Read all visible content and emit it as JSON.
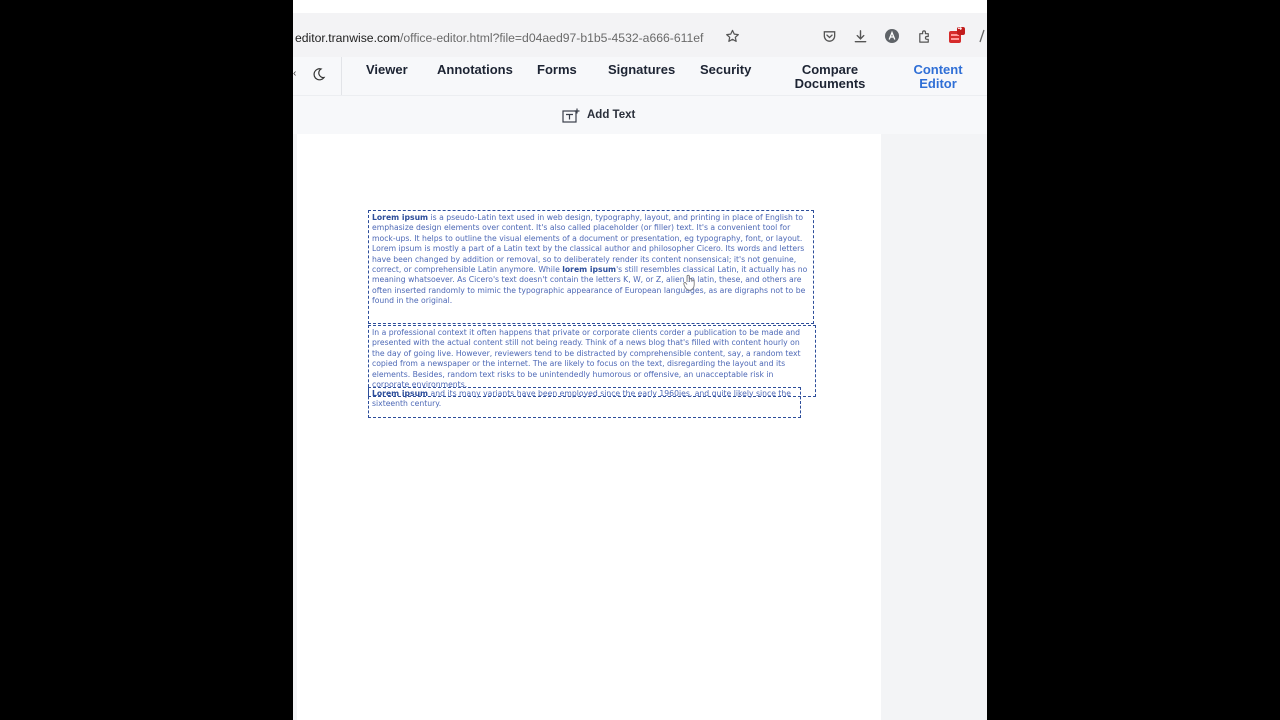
{
  "browser": {
    "url_domain": "editor.tranwise.com",
    "url_path": "/office-editor.html?file=d04aed97-b1b5-4532-a666-611ef"
  },
  "nav": {
    "tabs": [
      {
        "label": "Viewer"
      },
      {
        "label": "Annotations"
      },
      {
        "label": "Forms"
      },
      {
        "label": "Signatures"
      },
      {
        "label": "Security"
      },
      {
        "label": "Compare Documents"
      },
      {
        "label": "Content Editor"
      }
    ]
  },
  "toolbar": {
    "add_text_label": "Add Text"
  },
  "badges": {
    "extension_count": "4"
  },
  "colors": {
    "accent": "#2f6fd6",
    "textbox_border": "#2c4d9a",
    "text": "#4e69b6"
  },
  "document": {
    "block1": {
      "lead": "Lorem ipsum",
      "part1": " is a pseudo-Latin text used in web design, typography, layout, and printing in place of English to emphasize design elements over content. It's also called placeholder (or filler) text. It's a convenient tool for mock-ups. It helps to outline the visual elements of a document or presentation, eg typography, font, or layout. Lorem ipsum is mostly a part of a Latin text by the classical author and philosopher Cicero. Its words and letters have been changed by addition or removal, so to deliberately render its content nonsensical; it's not genuine, correct, or comprehensible Latin anymore. While ",
      "bold2": "lorem ipsum",
      "part2": "'s still resembles classical Latin, it actually has no meaning whatsoever. As Cicero's text doesn't contain the letters K, W, or Z, alien to latin, these, and others are often inserted randomly to mimic the typographic appearance of European languages, as are digraphs not to be found in the original."
    },
    "block2": {
      "text": "In a professional context it often happens that private or corporate clients corder a publication to be made and presented with the actual content still not being ready. Think of a news blog that's filled with content hourly on the day of going live. However, reviewers tend to be distracted by comprehensible content, say, a random text copied from a newspaper or the internet. The are likely to focus on the text, disregarding the layout and its elements. Besides, random text risks to be unintendedly humorous or offensive, an unacceptable risk in corporate environments."
    },
    "block3": {
      "lead": "Lorem ipsum",
      "text": " and its many variants have been employed since the early 1960ies, and quite likely since the sixteenth century."
    }
  }
}
